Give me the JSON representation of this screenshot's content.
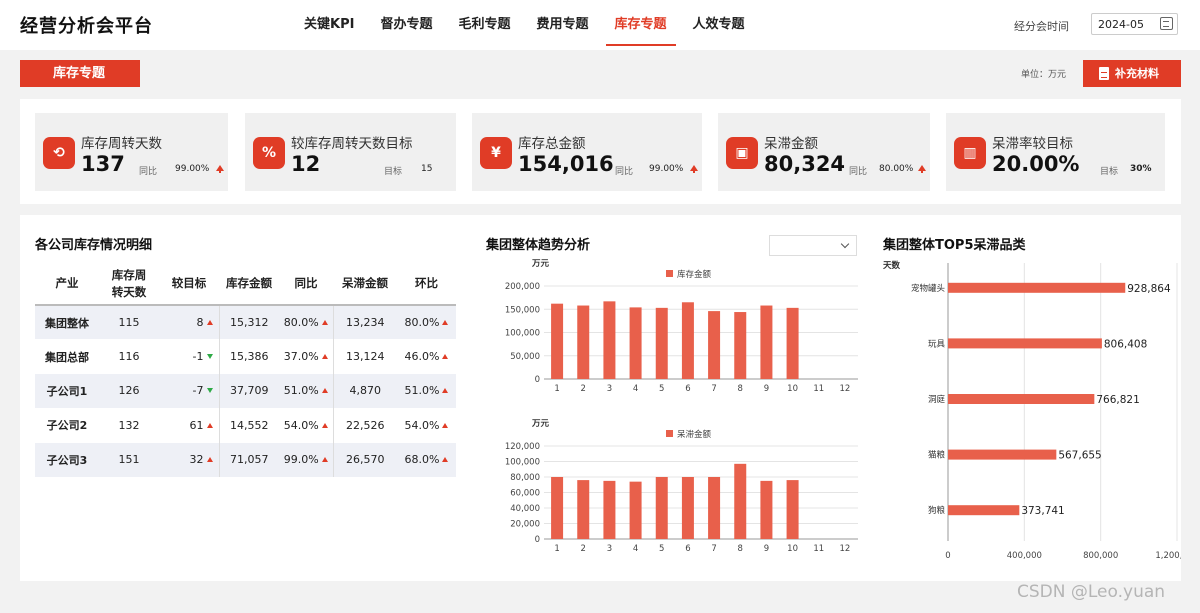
{
  "app": {
    "title": "经营分析会平台"
  },
  "nav": {
    "items": [
      {
        "label": "关键KPI",
        "active": false
      },
      {
        "label": "督办专题",
        "active": false
      },
      {
        "label": "毛利专题",
        "active": false
      },
      {
        "label": "费用专题",
        "active": false
      },
      {
        "label": "库存专题",
        "active": true
      },
      {
        "label": "人效专题",
        "active": false
      }
    ]
  },
  "period": {
    "label": "经分会时间",
    "value": "2024-05"
  },
  "section": {
    "title": "库存专题",
    "unit_label": "单位：万元",
    "supplement_button": "补充材料"
  },
  "accent_color": "#e03c26",
  "kpis": [
    {
      "title": "库存周转天数",
      "value": "137",
      "sub_label": "同比",
      "sub_value": "99.00%",
      "trend": "up",
      "icon": "refresh-icon"
    },
    {
      "title": "较库存周转天数目标",
      "value": "12",
      "sub_label": "目标",
      "sub_value": "15",
      "trend": "",
      "icon": "percent-icon"
    },
    {
      "title": "库存总金额",
      "value": "154,016",
      "sub_label": "同比",
      "sub_value": "99.00%",
      "trend": "up",
      "icon": "box-icon"
    },
    {
      "title": "呆滞金额",
      "value": "80,324",
      "sub_label": "同比",
      "sub_value": "80.00%",
      "trend": "up",
      "icon": "wallet-icon"
    },
    {
      "title": "呆滞率较目标",
      "value": "20.00%",
      "sub_label": "目标",
      "sub_value": "30%",
      "trend": "",
      "icon": "bar-chart-icon"
    }
  ],
  "table": {
    "title": "各公司库存情况明细",
    "headers": [
      "产业",
      "库存周转天数",
      "较目标",
      "库存金额",
      "同比",
      "呆滞金额",
      "环比"
    ],
    "rows": [
      {
        "name": "集团整体",
        "days": "115",
        "vs_target": "8",
        "vs_dir": "up",
        "amount": "15,312",
        "yoy": "80.0%",
        "stale": "13,234",
        "mom": "80.0%"
      },
      {
        "name": "集团总部",
        "days": "116",
        "vs_target": "-1",
        "vs_dir": "down",
        "amount": "15,386",
        "yoy": "37.0%",
        "stale": "13,124",
        "mom": "46.0%"
      },
      {
        "name": "子公司1",
        "days": "126",
        "vs_target": "-7",
        "vs_dir": "down",
        "amount": "37,709",
        "yoy": "51.0%",
        "stale": "4,870",
        "mom": "51.0%"
      },
      {
        "name": "子公司2",
        "days": "132",
        "vs_target": "61",
        "vs_dir": "up",
        "amount": "14,552",
        "yoy": "54.0%",
        "stale": "22,526",
        "mom": "54.0%"
      },
      {
        "name": "子公司3",
        "days": "151",
        "vs_target": "32",
        "vs_dir": "up",
        "amount": "71,057",
        "yoy": "99.0%",
        "stale": "26,570",
        "mom": "68.0%"
      }
    ]
  },
  "trend": {
    "title": "集团整体趋势分析",
    "select_value": ""
  },
  "top5": {
    "title": "集团整体TOP5呆滞品类"
  },
  "chart_data": [
    {
      "type": "bar",
      "title": "",
      "ylabel": "万元",
      "categories": [
        "1",
        "2",
        "3",
        "4",
        "5",
        "6",
        "7",
        "8",
        "9",
        "10",
        "11",
        "12"
      ],
      "series": [
        {
          "name": "库存金额",
          "values": [
            162000,
            158000,
            167000,
            154000,
            153000,
            165000,
            146000,
            144000,
            158000,
            153000,
            null,
            null
          ]
        }
      ],
      "ylim": [
        0,
        200000
      ],
      "yticks": [
        "0",
        "50,000",
        "100,000",
        "150,000",
        "200,000"
      ],
      "legend": "top-center",
      "grid": true,
      "color": "#e8604b"
    },
    {
      "type": "bar",
      "title": "",
      "ylabel": "万元",
      "categories": [
        "1",
        "2",
        "3",
        "4",
        "5",
        "6",
        "7",
        "8",
        "9",
        "10",
        "11",
        "12"
      ],
      "series": [
        {
          "name": "呆滞金额",
          "values": [
            80000,
            76000,
            75000,
            74000,
            80000,
            80000,
            80000,
            97000,
            75000,
            76000,
            null,
            null
          ]
        }
      ],
      "ylim": [
        0,
        120000
      ],
      "yticks": [
        "0",
        "20,000",
        "40,000",
        "60,000",
        "80,000",
        "100,000",
        "120,000"
      ],
      "legend": "top-center",
      "grid": true,
      "color": "#e8604b"
    },
    {
      "type": "bar",
      "orientation": "horizontal",
      "title": "",
      "ylabel": "天数",
      "categories": [
        "宠物罐头",
        "玩具",
        "洞庭",
        "猫粮",
        "狗粮"
      ],
      "series": [
        {
          "name": "",
          "values": [
            928864,
            806408,
            766821,
            567655,
            373741
          ],
          "labels": [
            "928,864",
            "806,408",
            "766,821",
            "567,655",
            "373,741"
          ]
        }
      ],
      "xlim": [
        0,
        1200000
      ],
      "xticks": [
        "0",
        "400,000",
        "800,000",
        "1,200,000"
      ],
      "grid": true,
      "color": "#e8604b"
    }
  ],
  "watermark": "CSDN @Leo.yuan"
}
